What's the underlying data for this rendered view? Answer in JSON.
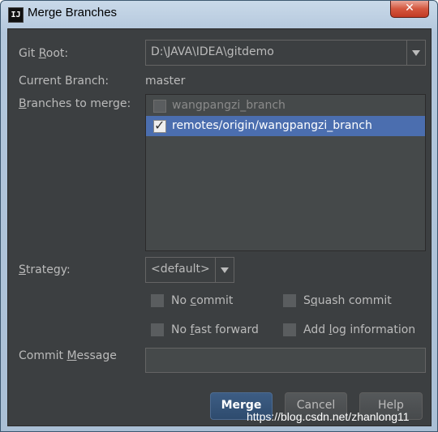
{
  "window": {
    "title": "Merge Branches",
    "icon_text": "IJ",
    "close_glyph": "✕"
  },
  "form": {
    "git_root": {
      "label_pre": "Git ",
      "label_key": "R",
      "label_post": "oot:",
      "value": "D:\\JAVA\\IDEA\\gitdemo"
    },
    "current_branch": {
      "label": "Current Branch:",
      "value": "master"
    },
    "branches_to_merge": {
      "label_key": "B",
      "label_post": "ranches to merge:",
      "items": [
        {
          "label": "wangpangzi_branch",
          "checked": false,
          "selected": false
        },
        {
          "label": "remotes/origin/wangpangzi_branch",
          "checked": true,
          "selected": true
        }
      ]
    },
    "strategy": {
      "label_key": "S",
      "label_post": "trategy:",
      "value": "<default>"
    },
    "options": {
      "no_commit": {
        "pre": "No ",
        "key": "c",
        "post": "ommit",
        "checked": false
      },
      "squash_commit": {
        "pre": "S",
        "key": "q",
        "post": "uash commit",
        "checked": false
      },
      "no_fast_forward": {
        "pre": "No ",
        "key": "f",
        "post": "ast forward",
        "checked": false
      },
      "add_log_information": {
        "pre": "Add ",
        "key": "l",
        "post": "og information",
        "checked": false
      }
    },
    "commit_message": {
      "label_pre": "Commit ",
      "label_key": "M",
      "label_post": "essage",
      "value": ""
    }
  },
  "buttons": {
    "merge": "Merge",
    "cancel": "Cancel",
    "help": "Help"
  },
  "watermark": "https://blog.csdn.net/zhanlong11",
  "colors": {
    "background": "#3c3f41",
    "selection": "#4b6eaf",
    "text": "#bbbbbb",
    "title_bar": "#b3c7dc",
    "close_button": "#d4563e"
  }
}
